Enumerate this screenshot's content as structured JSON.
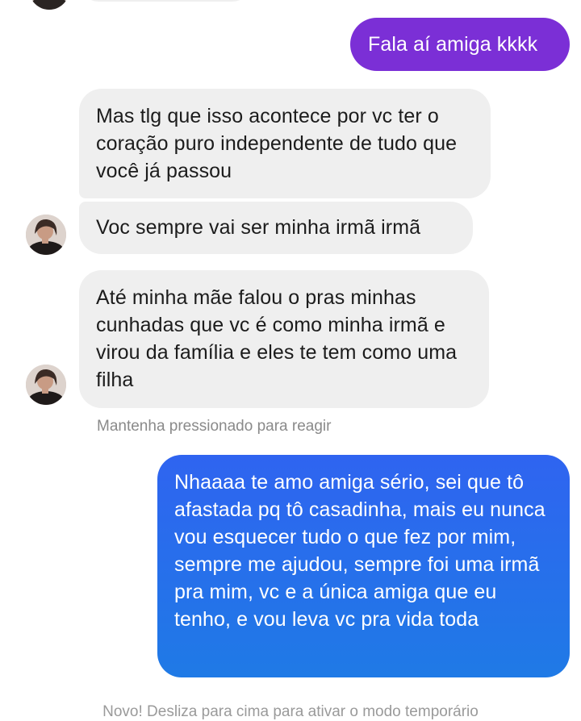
{
  "messages": [
    {
      "direction": "outgoing",
      "text": "Fala aí amiga kkkk"
    },
    {
      "direction": "incoming",
      "text": "Mas tlg que isso acontece por vc ter o coração puro independente de tudo que você já passou"
    },
    {
      "direction": "incoming",
      "text": "Voc sempre vai ser minha irmã irmã"
    },
    {
      "direction": "incoming",
      "text": "Até minha mãe falou o pras minhas cunhadas que vc é como minha irmã e virou da família e eles te tem como uma filha"
    },
    {
      "direction": "outgoing",
      "text": "Nhaaaa te amo amiga sério, sei que tô afastada pq tô casadinha, mais eu nunca vou esquecer tudo o que fez por mim, sempre me ajudou, sempre foi uma irmã pra mim, vc e a única amiga que eu tenho, e vou leva vc pra vida toda"
    }
  ],
  "reaction_hint": "Mantenha pressionado para reagir",
  "footer_hint": "Novo! Desliza para cima para ativar o modo temporário",
  "colors": {
    "incoming_bubble": "#efefef",
    "outgoing_purple": "#7b2fd6",
    "outgoing_blue_top": "#2f64f0",
    "outgoing_blue_bottom": "#1f7ae6",
    "hint_text": "#8a8a8a"
  },
  "icons": {
    "avatar": "contact-avatar-photo"
  }
}
